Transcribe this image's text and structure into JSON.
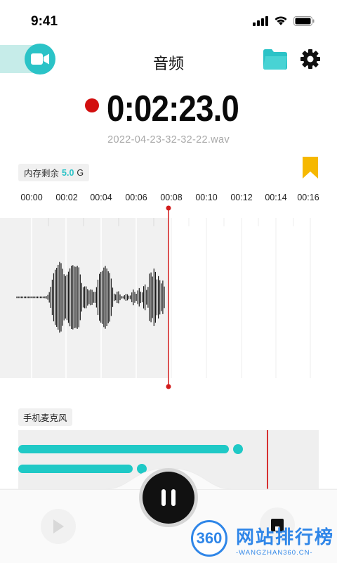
{
  "status_bar": {
    "time": "9:41"
  },
  "header": {
    "title": "音频"
  },
  "recorder": {
    "timer": "0:02:23.0",
    "filename": "2022-04-23-32-32-22.wav",
    "storage_label": "内存剩余",
    "storage_value": "5.0",
    "storage_unit": "G"
  },
  "timeline": {
    "ticks": [
      "00:00",
      "00:02",
      "00:04",
      "00:06",
      "00:08",
      "00:10",
      "00:12",
      "00:14",
      "00:16"
    ]
  },
  "mic": {
    "label": "手机麦克风",
    "levels": [
      0.7,
      0.38
    ]
  },
  "watermark": {
    "logo": "360",
    "text": "网站排行榜",
    "sub": "-WANGZHAN360.CN-"
  },
  "colors": {
    "accent": "#2bc3c7",
    "record": "#d20f0f",
    "bookmark": "#f6b800",
    "folder": "#2bc3c7"
  },
  "icons": {
    "video": "video-camera-icon",
    "folder": "folder-icon",
    "settings": "gear-icon",
    "bookmark": "bookmark-icon",
    "play": "play-icon",
    "pause": "pause-icon",
    "save": "save-icon"
  }
}
